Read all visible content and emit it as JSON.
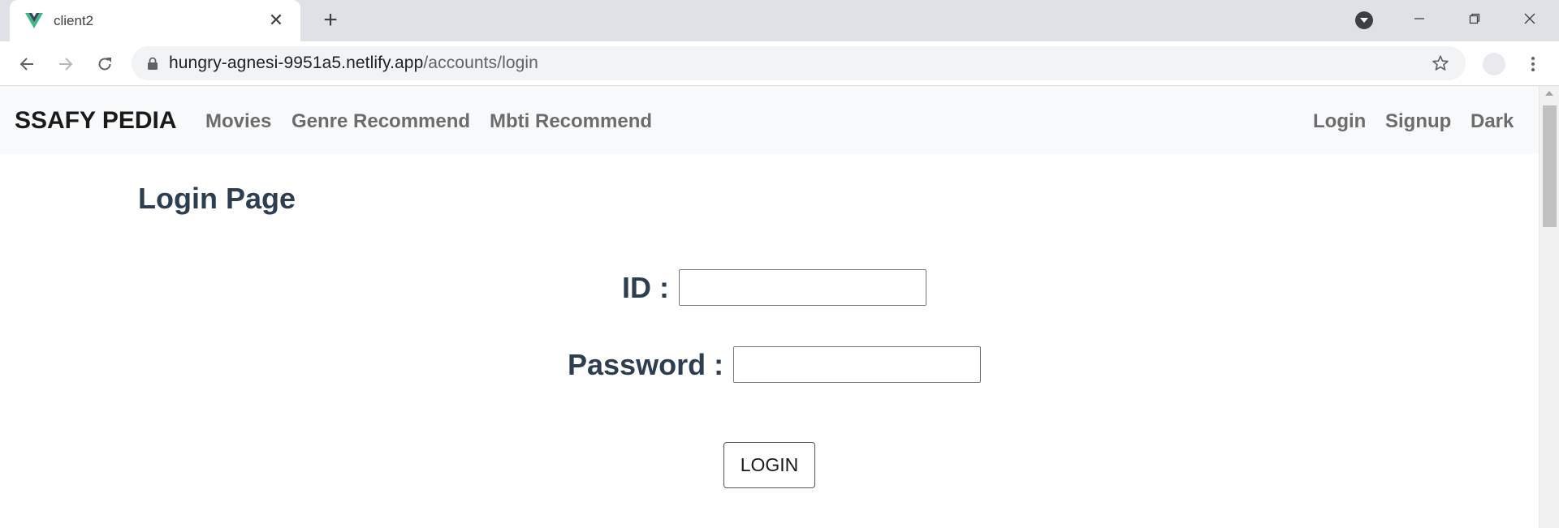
{
  "browser": {
    "tab_title": "client2",
    "tab_close": "✕",
    "new_tab": "+",
    "url_host": "hungry-agnesi-9951a5.netlify.app",
    "url_path": "/accounts/login"
  },
  "navbar": {
    "brand": "SSAFY PEDIA",
    "links": [
      "Movies",
      "Genre Recommend",
      "Mbti Recommend"
    ],
    "right_links": [
      "Login",
      "Signup",
      "Dark"
    ]
  },
  "login": {
    "title": "Login Page",
    "id_label": "ID :",
    "id_value": "",
    "password_label": "Password :",
    "password_value": "",
    "button_label": "LOGIN"
  },
  "colors": {
    "heading": "#2c3e50",
    "navbar_bg": "#f8f9fa",
    "nav_link": "#6c6c6c",
    "vue_green": "#41b883",
    "vue_dark": "#35495e"
  },
  "icons": [
    "vue-favicon-icon",
    "close-icon",
    "plus-icon",
    "profile-dropdown-icon",
    "minimize-icon",
    "restore-icon",
    "window-close-icon",
    "back-arrow-icon",
    "forward-arrow-icon",
    "reload-icon",
    "lock-icon",
    "star-icon",
    "extension-icon",
    "menu-dots-icon"
  ]
}
